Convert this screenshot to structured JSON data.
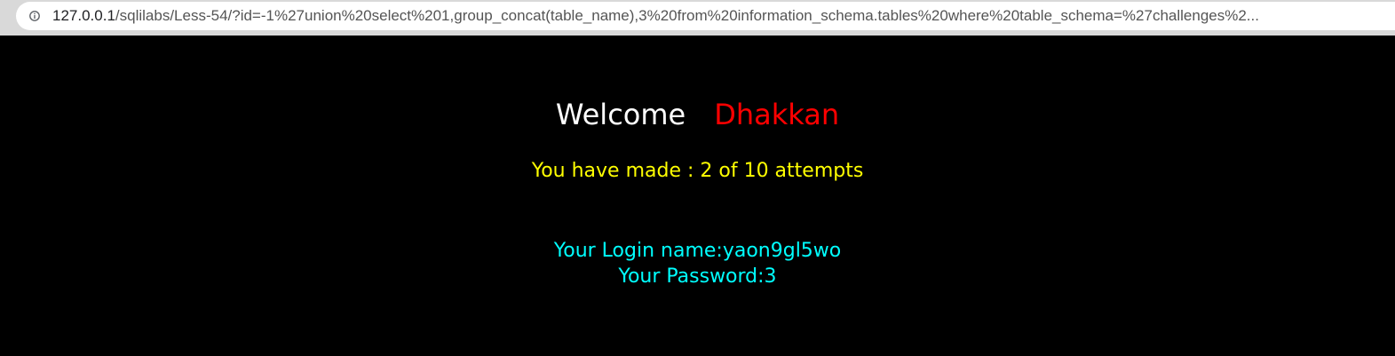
{
  "browser": {
    "url_host": "127.0.0.1",
    "url_path": "/sqlilabs/Less-54/?id=-1%27union%20select%201,group_concat(table_name),3%20from%20information_schema.tables%20where%20table_schema=%27challenges%2..."
  },
  "page": {
    "welcome_label": "Welcome",
    "welcome_name": "Dhakkan",
    "attempts_text": "You have made : 2 of 10 attempts",
    "login_name_text": "Your Login name:yaon9gl5wo",
    "password_text": "Your Password:3"
  },
  "colors": {
    "background": "#000000",
    "welcome_label": "#ffffff",
    "welcome_name": "#ff0000",
    "attempts": "#ffff00",
    "login": "#00ffff"
  },
  "icons": {
    "address_bar": "info-icon"
  }
}
